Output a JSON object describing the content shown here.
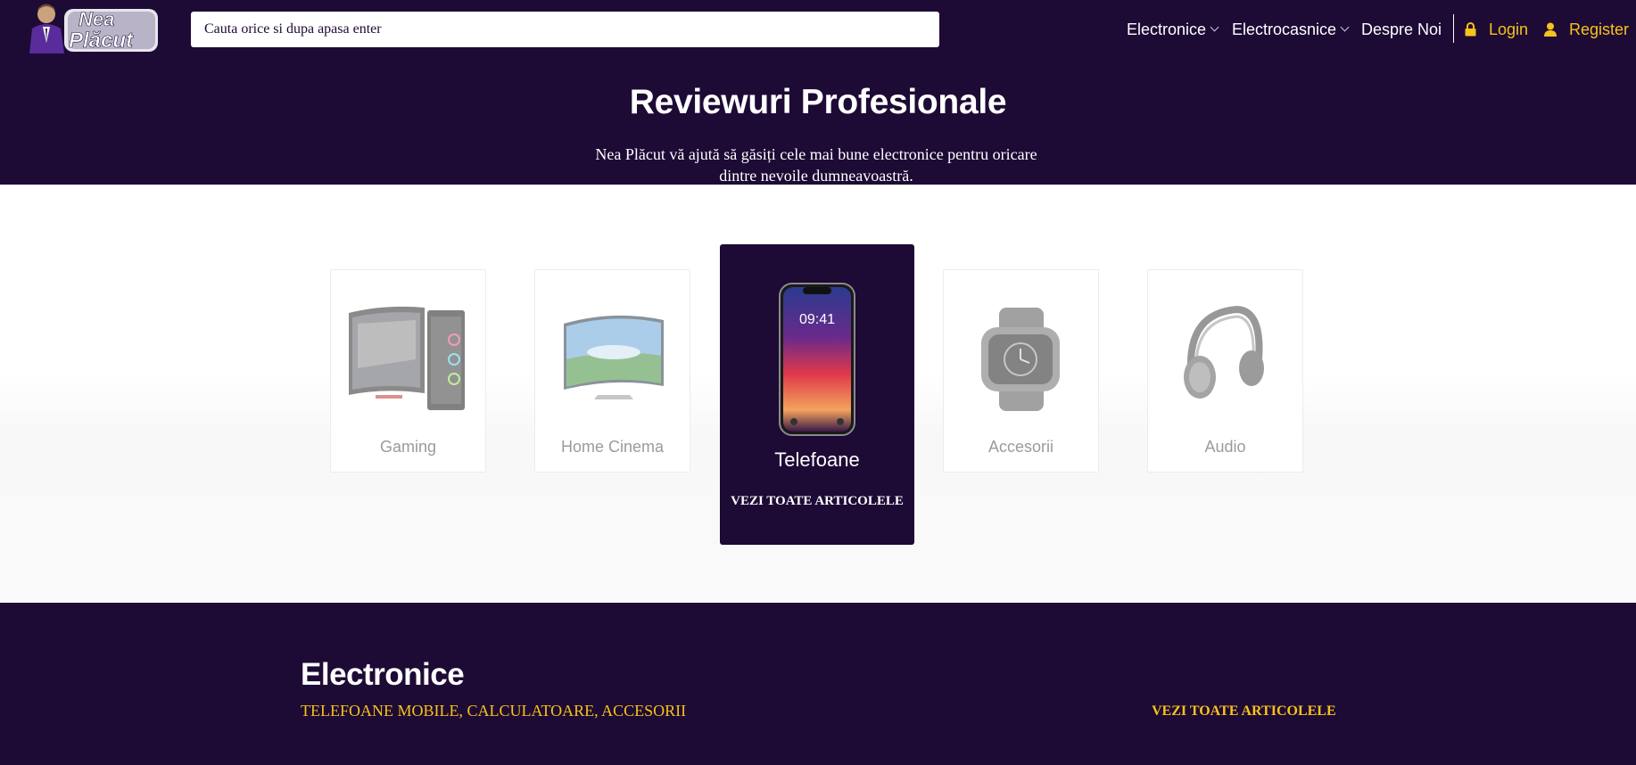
{
  "header": {
    "logo_text_line1": "Nea",
    "logo_text_line2": "Plăcut",
    "search_placeholder": "Cauta orice si dupa apasa enter",
    "nav": [
      {
        "label": "Electronice"
      },
      {
        "label": "Electrocasnice"
      },
      {
        "label": "Despre Noi"
      }
    ],
    "login": "Login",
    "register": "Register"
  },
  "hero": {
    "title": "Reviewuri Profesionale",
    "subtitle": "Nea Plăcut vă ajută să găsiți cele mai bune electronice pentru oricare dintre nevoile dumneavoastră."
  },
  "categories": [
    {
      "label": "Gaming"
    },
    {
      "label": "Home Cinema"
    },
    {
      "label": "Telefoane",
      "active": true,
      "more": "VEZI TOATE ARTICOLELE",
      "phone_time": "09:41"
    },
    {
      "label": "Accesorii"
    },
    {
      "label": "Audio"
    }
  ],
  "section": {
    "title": "Electronice",
    "subtitle": "TELEFOANE MOBILE, CALCULATOARE, ACCESORII",
    "more": "VEZI TOATE ARTICOLELE"
  },
  "colors": {
    "brand_dark": "#1d0a35",
    "accent_yellow": "#f7c21a",
    "white": "#ffffff"
  }
}
